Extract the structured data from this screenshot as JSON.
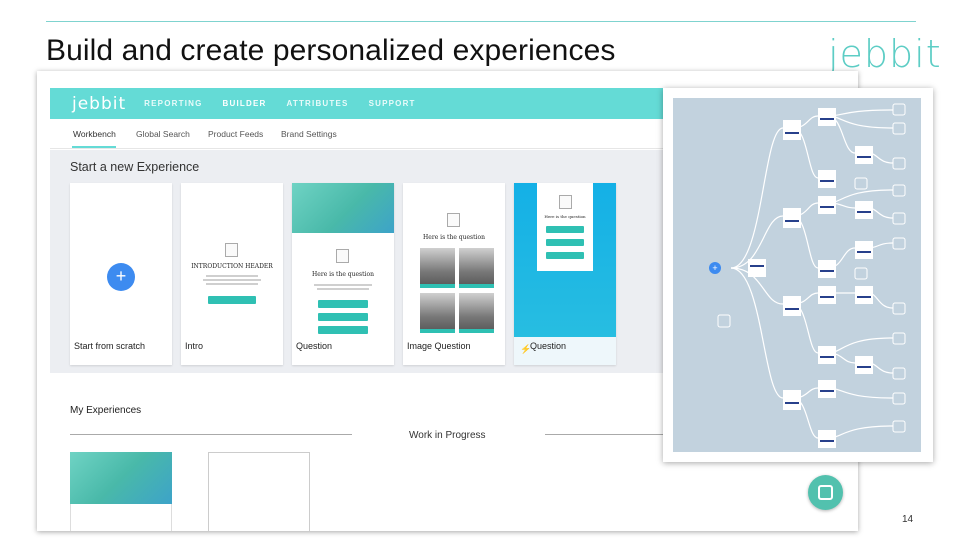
{
  "slide": {
    "title": "Build and create personalized experiences",
    "brand_logo": "jebbit",
    "page_number": "14"
  },
  "app": {
    "logo": "jebbit",
    "nav": [
      {
        "label": "REPORTING",
        "active": false
      },
      {
        "label": "BUILDER",
        "active": true
      },
      {
        "label": "ATTRIBUTES",
        "active": false
      },
      {
        "label": "SUPPORT",
        "active": false
      }
    ],
    "subnav": [
      {
        "label": "Workbench",
        "active": true
      },
      {
        "label": "Global Search",
        "active": false
      },
      {
        "label": "Product Feeds",
        "active": false
      },
      {
        "label": "Brand Settings",
        "active": false
      }
    ],
    "start_title": "Start a new Experience",
    "templates": [
      {
        "label": "Start from scratch"
      },
      {
        "label": "Intro"
      },
      {
        "label": "Question"
      },
      {
        "label": "Image Question"
      },
      {
        "label": "Question"
      }
    ],
    "intro_header": "INTRODUCTION HEADER",
    "question_text": "Here is the question",
    "my_experiences_title": "My Experiences",
    "work_in_progress": "Work in Progress"
  },
  "colors": {
    "teal": "#64dbd6",
    "blue_button": "#3d8bf0",
    "logo_teal": "#5dcdc5",
    "chat_green": "#52c1ae"
  },
  "icons": [
    "plus-icon",
    "chat-icon",
    "bolt-icon"
  ]
}
